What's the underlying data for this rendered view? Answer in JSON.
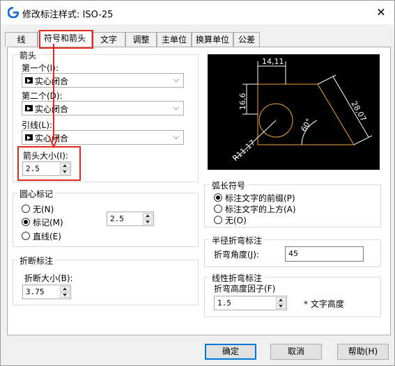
{
  "window": {
    "title": "修改标注样式: ISO-25"
  },
  "tabs": [
    {
      "label": "线"
    },
    {
      "label": "符号和箭头"
    },
    {
      "label": "文字"
    },
    {
      "label": "调整"
    },
    {
      "label": "主单位"
    },
    {
      "label": "换算单位"
    },
    {
      "label": "公差"
    }
  ],
  "arrowheads": {
    "title": "箭头",
    "first_label": "第一个(I):",
    "first_value": "实心闭合",
    "second_label": "第二个(D):",
    "second_value": "实心闭合",
    "leader_label": "引线(L):",
    "leader_value": "实心闭合",
    "size_label": "箭头大小(I):",
    "size_value": "2.5"
  },
  "center_marks": {
    "title": "圆心标记",
    "none": "无(N)",
    "mark": "标记(M)",
    "line": "直线(E)",
    "size_value": "2.5"
  },
  "dimension_break": {
    "title": "折断标注",
    "size_label": "折断大小(B):",
    "size_value": "3.75"
  },
  "preview": {
    "dim_top": "14,11",
    "dim_left": "16,6",
    "dim_right": "28,07",
    "dim_angle": "60°",
    "dim_radius": "R11,17"
  },
  "arc_length": {
    "title": "弧长符号",
    "prefix": "标注文字的前缀(P)",
    "above": "标注文字的上方(A)",
    "none": "无(O)"
  },
  "radius_jog": {
    "title": "半径折弯标注",
    "angle_label": "折弯角度(J):",
    "angle_value": "45"
  },
  "linear_jog": {
    "title": "线性折弯标注",
    "factor_label": "折弯高度因子(F)",
    "factor_value": "1.5",
    "suffix": "* 文字高度"
  },
  "buttons": {
    "ok": "确定",
    "cancel": "取消",
    "help": "帮助(H)"
  },
  "colors": {
    "annotation_red": "#e0291f",
    "preview_yellow": "#f5a623",
    "preview_white": "#ffffff",
    "focus_blue": "#0078d7"
  }
}
